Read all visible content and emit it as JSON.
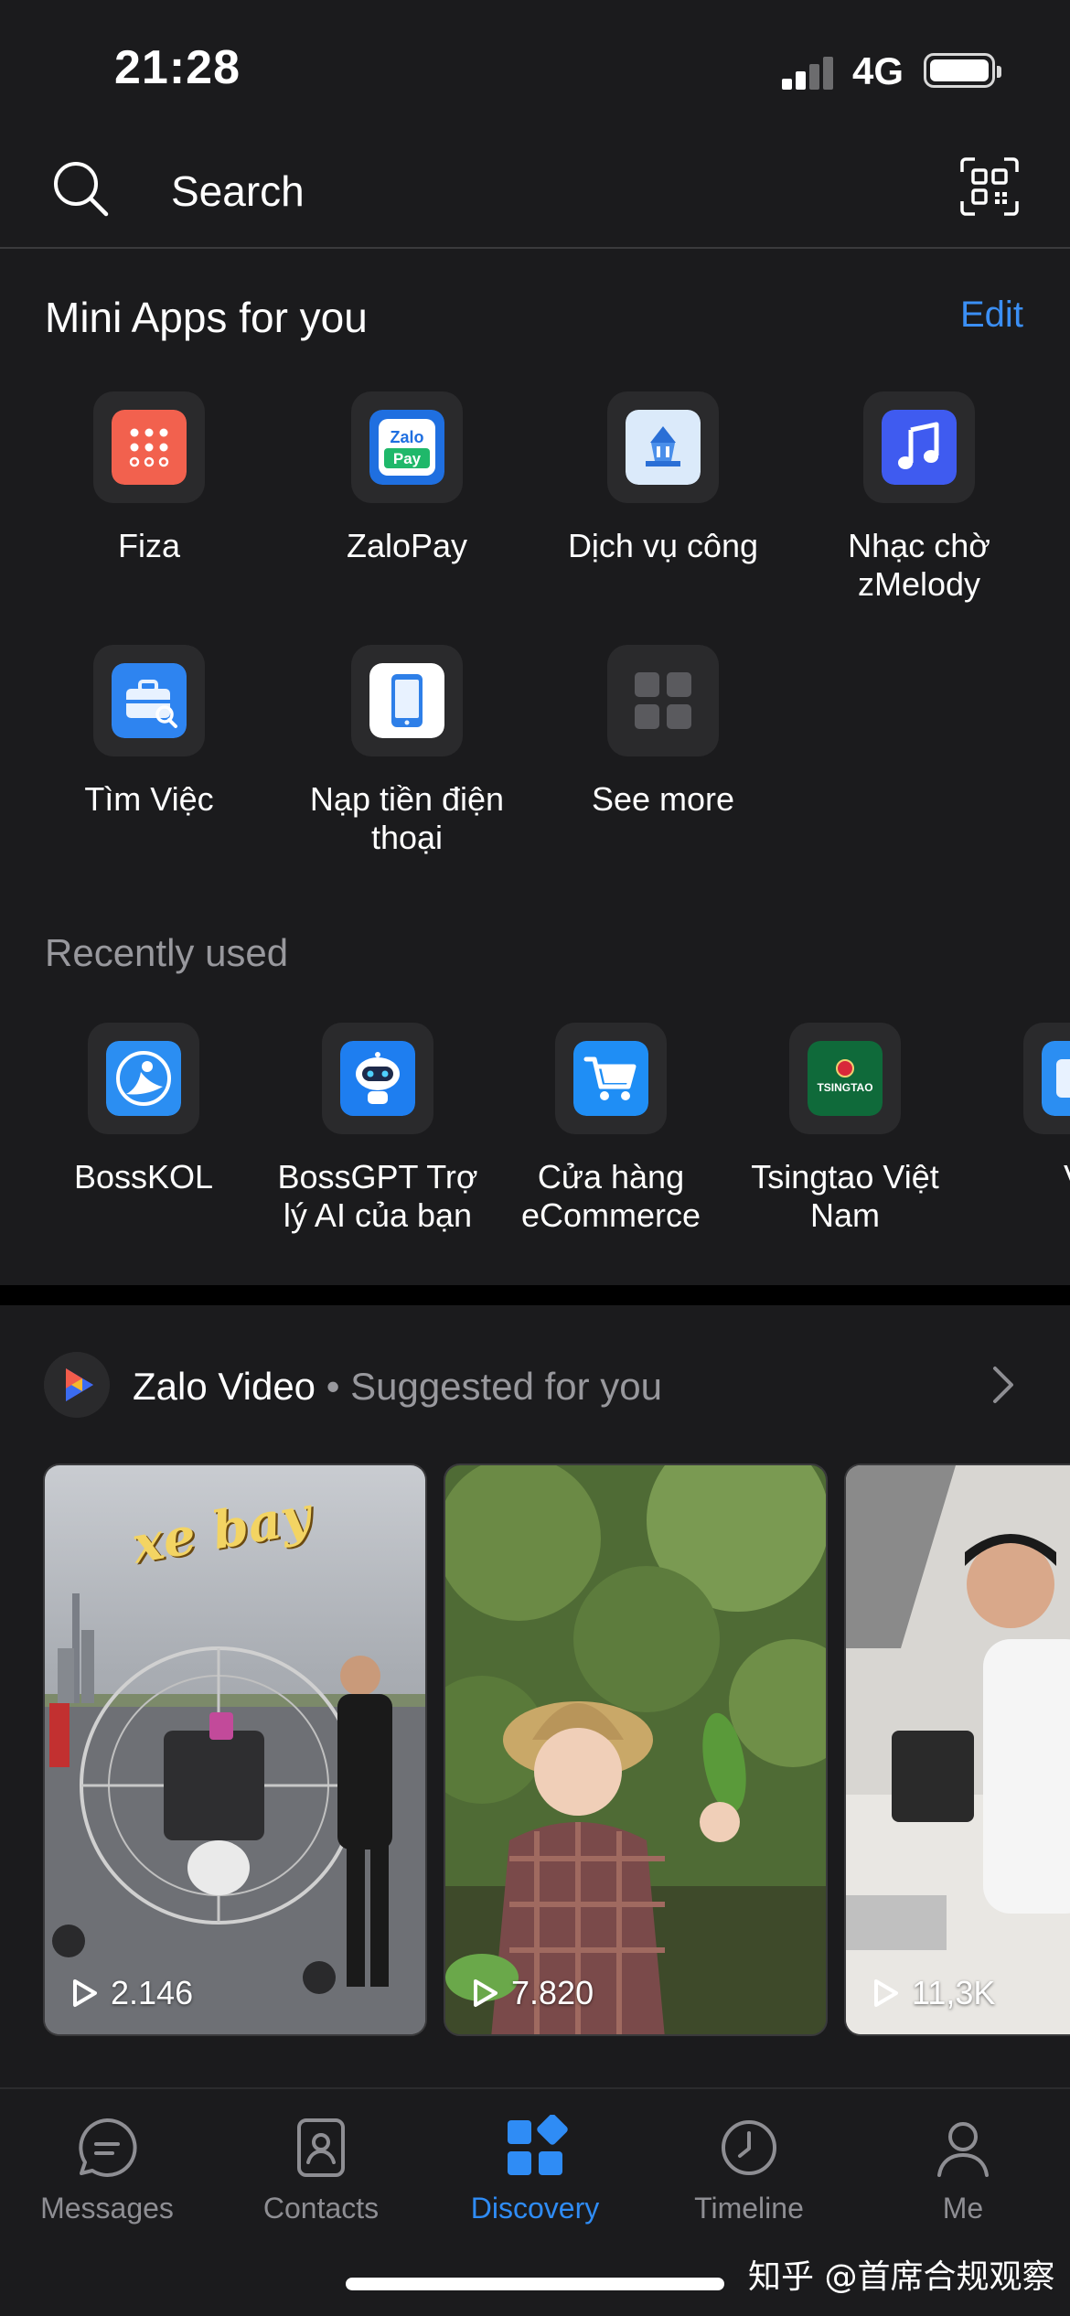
{
  "status_bar": {
    "time": "21:28",
    "network": "4G"
  },
  "search": {
    "placeholder": "Search"
  },
  "mini_apps": {
    "title": "Mini Apps for you",
    "edit_label": "Edit",
    "items": [
      {
        "label": "Fiza",
        "icon": "fiza-icon",
        "color": "#f2614e"
      },
      {
        "label": "ZaloPay",
        "icon": "zalopay-icon",
        "color": "#1f6fe0"
      },
      {
        "label": "Dịch vụ công",
        "icon": "public-service-icon",
        "color": "#dbeafa"
      },
      {
        "label": "Nhạc chờ zMelody",
        "icon": "music-note-icon",
        "color": "#3f5bf0"
      },
      {
        "label": "Tìm Việc",
        "icon": "briefcase-icon",
        "color": "#2e84f0"
      },
      {
        "label": "Nạp tiền điện thoại",
        "icon": "phone-icon",
        "color": "#ffffff"
      },
      {
        "label": "See more",
        "icon": "grid-icon",
        "color": "#2a2a2c"
      }
    ]
  },
  "recently_used": {
    "title": "Recently used",
    "items": [
      {
        "label": "BossKOL",
        "icon": "bosskol-icon",
        "color": "#2b8ef2"
      },
      {
        "label": "BossGPT Trợ lý AI của bạn",
        "icon": "robot-icon",
        "color": "#1e7ef0"
      },
      {
        "label": "Cửa hàng eCommerce",
        "icon": "cart-icon",
        "color": "#1f8ef5"
      },
      {
        "label": "Tsingtao Việt Nam",
        "icon": "tsingtao-icon",
        "color": "#0f6a3a",
        "logo_text": "TSINGTAO"
      },
      {
        "label": "Ví",
        "icon": "wallet-icon",
        "color": "#2b8ef2"
      }
    ]
  },
  "zalo_video": {
    "title": "Zalo Video",
    "separator": " • ",
    "subtitle": "Suggested for you",
    "videos": [
      {
        "views": "2.146",
        "overlay_text": "xe bay"
      },
      {
        "views": "7.820"
      },
      {
        "views": "11,3K"
      }
    ]
  },
  "tab_bar": {
    "tabs": [
      {
        "label": "Messages",
        "icon": "chat-bubble-icon",
        "active": false
      },
      {
        "label": "Contacts",
        "icon": "contact-card-icon",
        "active": false
      },
      {
        "label": "Discovery",
        "icon": "discovery-grid-icon",
        "active": true
      },
      {
        "label": "Timeline",
        "icon": "clock-icon",
        "active": false
      },
      {
        "label": "Me",
        "icon": "person-icon",
        "active": false
      }
    ]
  },
  "watermark": "知乎 @首席合规观察",
  "colors": {
    "accent": "#2f8cf5",
    "background": "#1b1b1d",
    "link": "#3b8ff5"
  }
}
